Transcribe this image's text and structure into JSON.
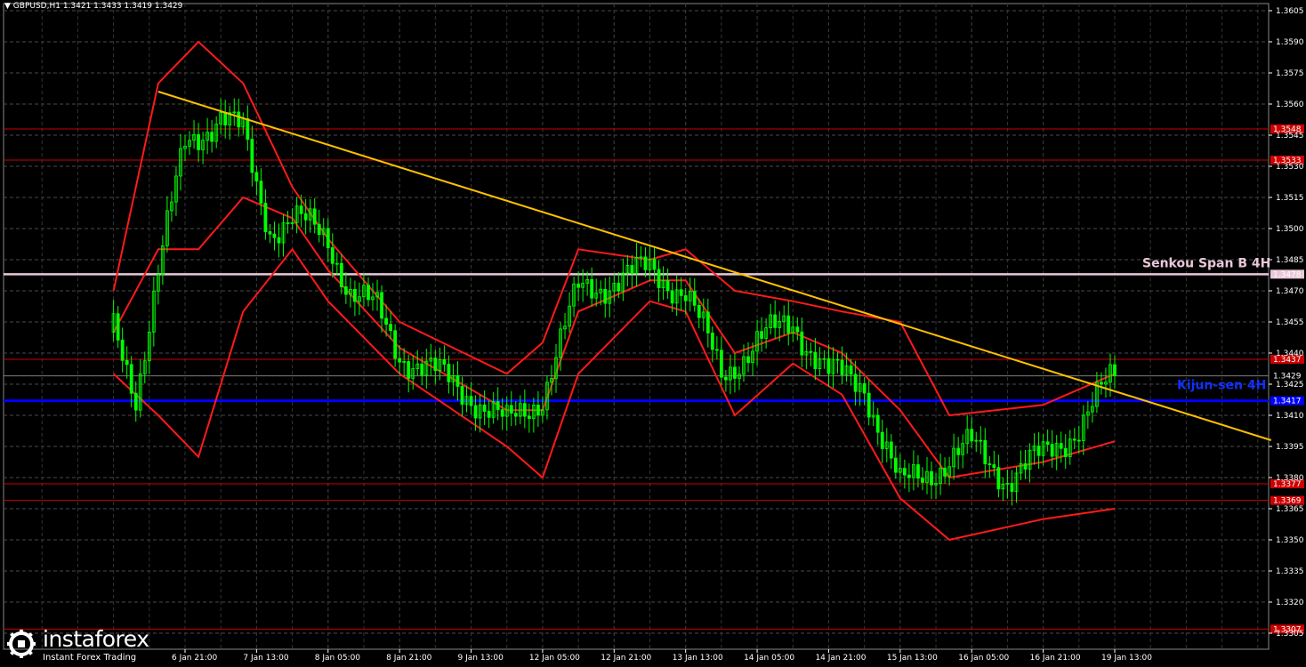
{
  "header": {
    "symbol_line": "GBPUSD,H1  1.3421 1.3433 1.3419 1.3429"
  },
  "watermark": {
    "brand": "instaforex",
    "tagline": "Instant Forex Trading"
  },
  "colors": {
    "background": "#000000",
    "grid": "#4a4a4a",
    "candle": "#00ff00",
    "band": "#ff1a1a",
    "level": "#cc0000",
    "trendline": "#ffc000",
    "senkou": "#e8c8d8",
    "kijun": "#0000ff",
    "last_price_line": "#7d7d7d"
  },
  "chart_data": {
    "type": "candlestick",
    "symbol": "GBPUSD",
    "timeframe": "H1",
    "ylim": [
      1.33,
      1.361
    ],
    "y_ticks": [
      "1.3605",
      "1.3590",
      "1.3575",
      "1.3560",
      "1.3545",
      "1.3530",
      "1.3515",
      "1.3500",
      "1.3485",
      "1.3470",
      "1.3455",
      "1.3440",
      "1.3425",
      "1.3410",
      "1.3395",
      "1.3380",
      "1.3365",
      "1.3350",
      "1.3335",
      "1.3320",
      "1.3305"
    ],
    "x_ticks": [
      "6 Jan 21:00",
      "7 Jan 13:00",
      "8 Jan 05:00",
      "8 Jan 21:00",
      "9 Jan 13:00",
      "12 Jan 05:00",
      "12 Jan 21:00",
      "13 Jan 13:00",
      "14 Jan 05:00",
      "14 Jan 21:00",
      "15 Jan 13:00",
      "16 Jan 05:00",
      "16 Jan 21:00",
      "19 Jan 13:00"
    ],
    "last": {
      "open": 1.3421,
      "high": 1.3433,
      "low": 1.3419,
      "close": 1.3429
    },
    "last_price_label": "1.3429",
    "levels": [
      {
        "name": "level-1.3548",
        "value": 1.3548,
        "label": "1.3548"
      },
      {
        "name": "level-1.3533",
        "value": 1.3533,
        "label": "1.3533"
      },
      {
        "name": "level-1.3437",
        "value": 1.3437,
        "label": "1.3437"
      },
      {
        "name": "level-1.3377",
        "value": 1.3377,
        "label": "1.3377"
      },
      {
        "name": "level-1.3369",
        "value": 1.3369,
        "label": "1.3369"
      },
      {
        "name": "level-1.3307",
        "value": 1.3307,
        "label": "1.3307"
      }
    ],
    "senkou_span_b": {
      "label": "Senkou Span B 4H",
      "value": 1.3478,
      "value_label": "1.3478"
    },
    "kijun_sen": {
      "label": "Kijun-sen 4H",
      "value": 1.3417,
      "value_label": "1.3417"
    },
    "trendline": {
      "start": {
        "x": "6 Jan 15:00",
        "y": 1.3566
      },
      "end": {
        "x": "21 Jan",
        "y": 1.3398
      }
    },
    "close_path": [
      [
        "6 Jan 05:00",
        1.345
      ],
      [
        "6 Jan 10:00",
        1.342
      ],
      [
        "6 Jan 15:00",
        1.348
      ],
      [
        "6 Jan 21:00",
        1.354
      ],
      [
        "7 Jan 05:00",
        1.3555
      ],
      [
        "7 Jan 10:00",
        1.3545
      ],
      [
        "7 Jan 13:00",
        1.352
      ],
      [
        "7 Jan 16:00",
        1.35
      ],
      [
        "7 Jan 21:00",
        1.3505
      ],
      [
        "8 Jan 05:00",
        1.3495
      ],
      [
        "8 Jan 10:00",
        1.347
      ],
      [
        "8 Jan 16:00",
        1.346
      ],
      [
        "8 Jan 21:00",
        1.344
      ],
      [
        "9 Jan 05:00",
        1.343
      ],
      [
        "9 Jan 13:00",
        1.342
      ],
      [
        "9 Jan 21:00",
        1.3405
      ],
      [
        "12 Jan 05:00",
        1.342
      ],
      [
        "12 Jan 13:00",
        1.347
      ],
      [
        "12 Jan 21:00",
        1.3475
      ],
      [
        "13 Jan 05:00",
        1.348
      ],
      [
        "13 Jan 13:00",
        1.347
      ],
      [
        "13 Jan 21:00",
        1.343
      ],
      [
        "14 Jan 05:00",
        1.3445
      ],
      [
        "14 Jan 13:00",
        1.3455
      ],
      [
        "14 Jan 21:00",
        1.343
      ],
      [
        "15 Jan 05:00",
        1.3425
      ],
      [
        "15 Jan 13:00",
        1.3375
      ],
      [
        "15 Jan 21:00",
        1.3385
      ],
      [
        "16 Jan 05:00",
        1.3395
      ],
      [
        "16 Jan 13:00",
        1.338
      ],
      [
        "16 Jan 21:00",
        1.339
      ],
      [
        "19 Jan 05:00",
        1.3405
      ],
      [
        "19 Jan 13:00",
        1.3429
      ]
    ],
    "upper_band": [
      [
        "6 Jan 05:00",
        1.347
      ],
      [
        "6 Jan 15:00",
        1.357
      ],
      [
        "7 Jan 00:00",
        1.359
      ],
      [
        "7 Jan 10:00",
        1.357
      ],
      [
        "7 Jan 21:00",
        1.352
      ],
      [
        "8 Jan 05:00",
        1.3495
      ],
      [
        "8 Jan 21:00",
        1.3455
      ],
      [
        "9 Jan 21:00",
        1.343
      ],
      [
        "12 Jan 05:00",
        1.3445
      ],
      [
        "12 Jan 13:00",
        1.349
      ],
      [
        "13 Jan 05:00",
        1.3485
      ],
      [
        "13 Jan 13:00",
        1.349
      ],
      [
        "14 Jan 00:00",
        1.347
      ],
      [
        "14 Jan 13:00",
        1.3465
      ],
      [
        "15 Jan 00:00",
        1.346
      ],
      [
        "15 Jan 13:00",
        1.3455
      ],
      [
        "16 Jan 00:00",
        1.341
      ],
      [
        "16 Jan 21:00",
        1.3415
      ],
      [
        "19 Jan 13:00",
        1.343
      ]
    ],
    "lower_band": [
      [
        "6 Jan 05:00",
        1.343
      ],
      [
        "6 Jan 15:00",
        1.341
      ],
      [
        "7 Jan 00:00",
        1.339
      ],
      [
        "7 Jan 10:00",
        1.346
      ],
      [
        "7 Jan 21:00",
        1.349
      ],
      [
        "8 Jan 05:00",
        1.3465
      ],
      [
        "8 Jan 21:00",
        1.343
      ],
      [
        "9 Jan 21:00",
        1.3395
      ],
      [
        "12 Jan 05:00",
        1.338
      ],
      [
        "12 Jan 13:00",
        1.343
      ],
      [
        "13 Jan 05:00",
        1.3465
      ],
      [
        "13 Jan 13:00",
        1.346
      ],
      [
        "14 Jan 00:00",
        1.341
      ],
      [
        "14 Jan 13:00",
        1.3435
      ],
      [
        "15 Jan 00:00",
        1.342
      ],
      [
        "15 Jan 13:00",
        1.337
      ],
      [
        "16 Jan 00:00",
        1.335
      ],
      [
        "16 Jan 21:00",
        1.336
      ],
      [
        "19 Jan 13:00",
        1.3365
      ]
    ]
  }
}
